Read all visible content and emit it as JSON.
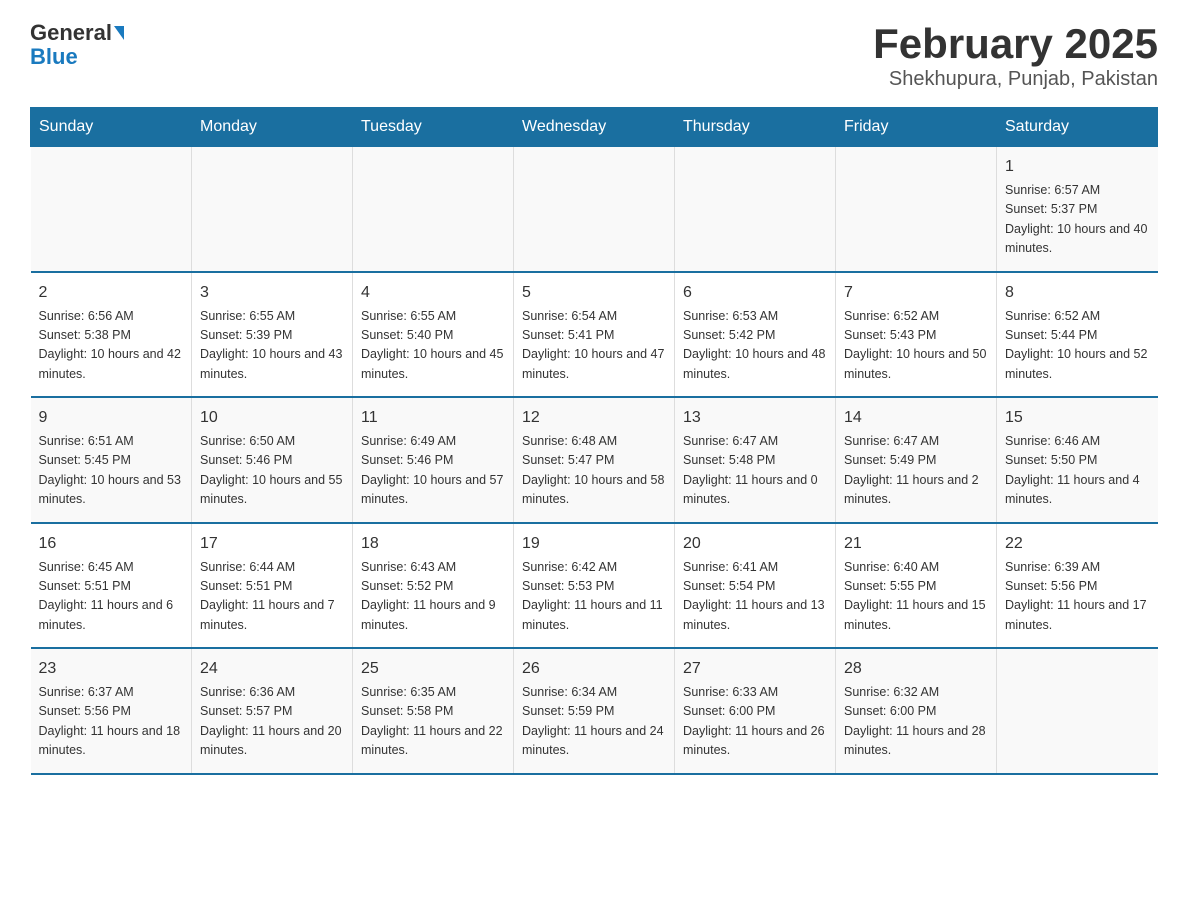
{
  "header": {
    "logo_general": "General",
    "logo_blue": "Blue",
    "title": "February 2025",
    "subtitle": "Shekhupura, Punjab, Pakistan"
  },
  "days_of_week": [
    "Sunday",
    "Monday",
    "Tuesday",
    "Wednesday",
    "Thursday",
    "Friday",
    "Saturday"
  ],
  "weeks": [
    [
      {
        "day": "",
        "info": ""
      },
      {
        "day": "",
        "info": ""
      },
      {
        "day": "",
        "info": ""
      },
      {
        "day": "",
        "info": ""
      },
      {
        "day": "",
        "info": ""
      },
      {
        "day": "",
        "info": ""
      },
      {
        "day": "1",
        "info": "Sunrise: 6:57 AM\nSunset: 5:37 PM\nDaylight: 10 hours and 40 minutes."
      }
    ],
    [
      {
        "day": "2",
        "info": "Sunrise: 6:56 AM\nSunset: 5:38 PM\nDaylight: 10 hours and 42 minutes."
      },
      {
        "day": "3",
        "info": "Sunrise: 6:55 AM\nSunset: 5:39 PM\nDaylight: 10 hours and 43 minutes."
      },
      {
        "day": "4",
        "info": "Sunrise: 6:55 AM\nSunset: 5:40 PM\nDaylight: 10 hours and 45 minutes."
      },
      {
        "day": "5",
        "info": "Sunrise: 6:54 AM\nSunset: 5:41 PM\nDaylight: 10 hours and 47 minutes."
      },
      {
        "day": "6",
        "info": "Sunrise: 6:53 AM\nSunset: 5:42 PM\nDaylight: 10 hours and 48 minutes."
      },
      {
        "day": "7",
        "info": "Sunrise: 6:52 AM\nSunset: 5:43 PM\nDaylight: 10 hours and 50 minutes."
      },
      {
        "day": "8",
        "info": "Sunrise: 6:52 AM\nSunset: 5:44 PM\nDaylight: 10 hours and 52 minutes."
      }
    ],
    [
      {
        "day": "9",
        "info": "Sunrise: 6:51 AM\nSunset: 5:45 PM\nDaylight: 10 hours and 53 minutes."
      },
      {
        "day": "10",
        "info": "Sunrise: 6:50 AM\nSunset: 5:46 PM\nDaylight: 10 hours and 55 minutes."
      },
      {
        "day": "11",
        "info": "Sunrise: 6:49 AM\nSunset: 5:46 PM\nDaylight: 10 hours and 57 minutes."
      },
      {
        "day": "12",
        "info": "Sunrise: 6:48 AM\nSunset: 5:47 PM\nDaylight: 10 hours and 58 minutes."
      },
      {
        "day": "13",
        "info": "Sunrise: 6:47 AM\nSunset: 5:48 PM\nDaylight: 11 hours and 0 minutes."
      },
      {
        "day": "14",
        "info": "Sunrise: 6:47 AM\nSunset: 5:49 PM\nDaylight: 11 hours and 2 minutes."
      },
      {
        "day": "15",
        "info": "Sunrise: 6:46 AM\nSunset: 5:50 PM\nDaylight: 11 hours and 4 minutes."
      }
    ],
    [
      {
        "day": "16",
        "info": "Sunrise: 6:45 AM\nSunset: 5:51 PM\nDaylight: 11 hours and 6 minutes."
      },
      {
        "day": "17",
        "info": "Sunrise: 6:44 AM\nSunset: 5:51 PM\nDaylight: 11 hours and 7 minutes."
      },
      {
        "day": "18",
        "info": "Sunrise: 6:43 AM\nSunset: 5:52 PM\nDaylight: 11 hours and 9 minutes."
      },
      {
        "day": "19",
        "info": "Sunrise: 6:42 AM\nSunset: 5:53 PM\nDaylight: 11 hours and 11 minutes."
      },
      {
        "day": "20",
        "info": "Sunrise: 6:41 AM\nSunset: 5:54 PM\nDaylight: 11 hours and 13 minutes."
      },
      {
        "day": "21",
        "info": "Sunrise: 6:40 AM\nSunset: 5:55 PM\nDaylight: 11 hours and 15 minutes."
      },
      {
        "day": "22",
        "info": "Sunrise: 6:39 AM\nSunset: 5:56 PM\nDaylight: 11 hours and 17 minutes."
      }
    ],
    [
      {
        "day": "23",
        "info": "Sunrise: 6:37 AM\nSunset: 5:56 PM\nDaylight: 11 hours and 18 minutes."
      },
      {
        "day": "24",
        "info": "Sunrise: 6:36 AM\nSunset: 5:57 PM\nDaylight: 11 hours and 20 minutes."
      },
      {
        "day": "25",
        "info": "Sunrise: 6:35 AM\nSunset: 5:58 PM\nDaylight: 11 hours and 22 minutes."
      },
      {
        "day": "26",
        "info": "Sunrise: 6:34 AM\nSunset: 5:59 PM\nDaylight: 11 hours and 24 minutes."
      },
      {
        "day": "27",
        "info": "Sunrise: 6:33 AM\nSunset: 6:00 PM\nDaylight: 11 hours and 26 minutes."
      },
      {
        "day": "28",
        "info": "Sunrise: 6:32 AM\nSunset: 6:00 PM\nDaylight: 11 hours and 28 minutes."
      },
      {
        "day": "",
        "info": ""
      }
    ]
  ]
}
